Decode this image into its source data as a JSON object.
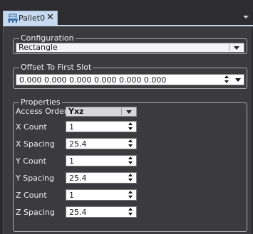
{
  "tab": {
    "label": "Pallet0",
    "close": "✕",
    "icon": "pallet-icon"
  },
  "configuration": {
    "legend": "Configuration",
    "value": "Rectangle"
  },
  "offset": {
    "legend": "Offset To First Slot",
    "value": "0.000 0.000 0.000 0.000 0.000 0.000"
  },
  "properties": {
    "legend": "Properties",
    "access_order_label": "Access Order",
    "access_order_value": "Yxz",
    "rows": [
      {
        "label": "X Count",
        "value": "1"
      },
      {
        "label": "X Spacing",
        "value": "25.4"
      },
      {
        "label": "Y Count",
        "value": "1"
      },
      {
        "label": "Y Spacing",
        "value": "25.4"
      },
      {
        "label": "Z Count",
        "value": "1"
      },
      {
        "label": "Z Spacing",
        "value": "25.4"
      }
    ]
  },
  "colors": {
    "tab_active": "#c7daf0",
    "panel_bg": "#3b3b3f",
    "window_bg": "#2d2d30"
  }
}
